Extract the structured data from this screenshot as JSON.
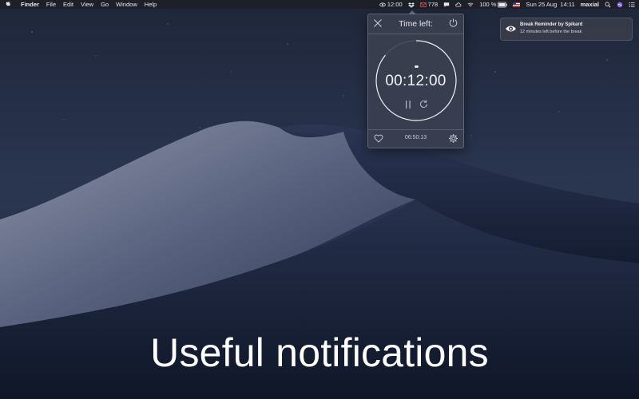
{
  "menubar": {
    "apple_icon": "apple-logo-icon",
    "app_name": "Finder",
    "menus": [
      "File",
      "Edit",
      "View",
      "Go",
      "Window",
      "Help"
    ],
    "status": {
      "timer": "12:00",
      "mail_count": "778",
      "battery": "100 %",
      "datetime": "Sun 25 Aug  14:11",
      "user": "maxial"
    }
  },
  "popover": {
    "title": "Time left:",
    "dots": "••",
    "time_remaining": "00:12:00",
    "progress_fraction": 0.86,
    "elapsed": "06:50:13"
  },
  "notification": {
    "title": "Break Reminder by Spikard",
    "body": "12 minutes left before the break"
  },
  "caption": "Useful notifications"
}
